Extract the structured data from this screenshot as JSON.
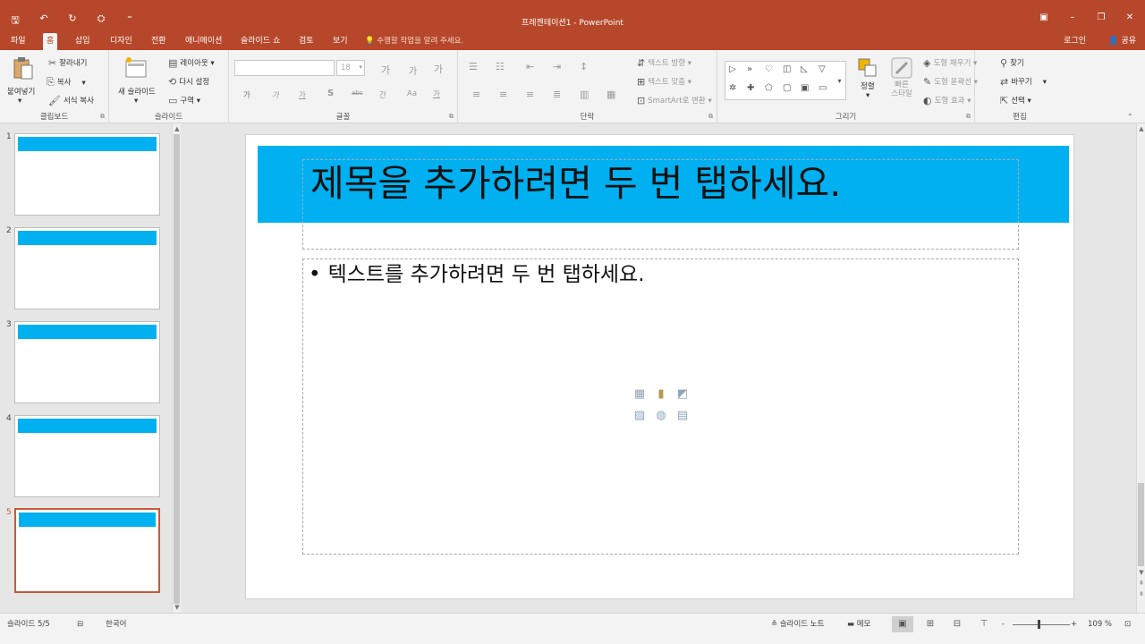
{
  "titlebar": {
    "title": "프레젠테이션1 - PowerPoint",
    "qat": [
      "🖫",
      "↶",
      "↻",
      "⛭",
      "⁼"
    ],
    "window_controls": [
      "▣",
      "–",
      "❐",
      "✕"
    ]
  },
  "tabs": {
    "items": [
      "파일",
      "홈",
      "삽입",
      "디자인",
      "전환",
      "애니메이션",
      "슬라이드 쇼",
      "검토",
      "보기"
    ],
    "tell_me": "수행할 작업을 알려 주세요.",
    "sign_in": "로그인",
    "share": "공유"
  },
  "ribbon": {
    "clipboard": {
      "paste": "붙여넣기",
      "cut": "잘라내기",
      "copy": "복사",
      "format_painter": "서식 복사",
      "label": "클립보드"
    },
    "slides": {
      "new_slide": "새 슬라이드",
      "layout": "레이아웃",
      "reset": "다시 설정",
      "section": "구역",
      "label": "슬라이드"
    },
    "font": {
      "size": "18",
      "btn_grow": "가",
      "btn_shrink": "가",
      "btn_clear": "가",
      "bold": "가",
      "italic": "가",
      "underline": "가",
      "shadow": "S",
      "strike": "abc",
      "spacing": "간",
      "case": "Aa",
      "color": "가",
      "label": "글꼴"
    },
    "paragraph": {
      "text_direction": "텍스트 방향",
      "align_text": "텍스트 맞춤",
      "smartart": "SmartArt로 변환",
      "label": "단락"
    },
    "drawing": {
      "arrange": "정렬",
      "quick_styles": "빠른 스타일",
      "shape_fill": "도형 채우기",
      "shape_outline": "도형 윤곽선",
      "shape_effects": "도형 효과",
      "label": "그리기"
    },
    "editing": {
      "find": "찾기",
      "replace": "바꾸기",
      "select": "선택",
      "label": "편집"
    }
  },
  "thumbnails": [
    "1",
    "2",
    "3",
    "4",
    "5"
  ],
  "slide": {
    "title": "제목을 추가하려면 두 번 탭하세요.",
    "body": "텍스트를 추가하려면 두 번 탭하세요.",
    "bullet": "•"
  },
  "statusbar": {
    "slide_count": "슬라이드 5/5",
    "language": "한국어",
    "notes": "슬라이드 노트",
    "comments": "메모",
    "zoom_minus": "-",
    "zoom_plus": "+",
    "zoom": "109 %"
  },
  "colors": {
    "accent": "#b7472a",
    "title_band": "#00b0f0",
    "selected_thumb": "#c55a3a"
  }
}
